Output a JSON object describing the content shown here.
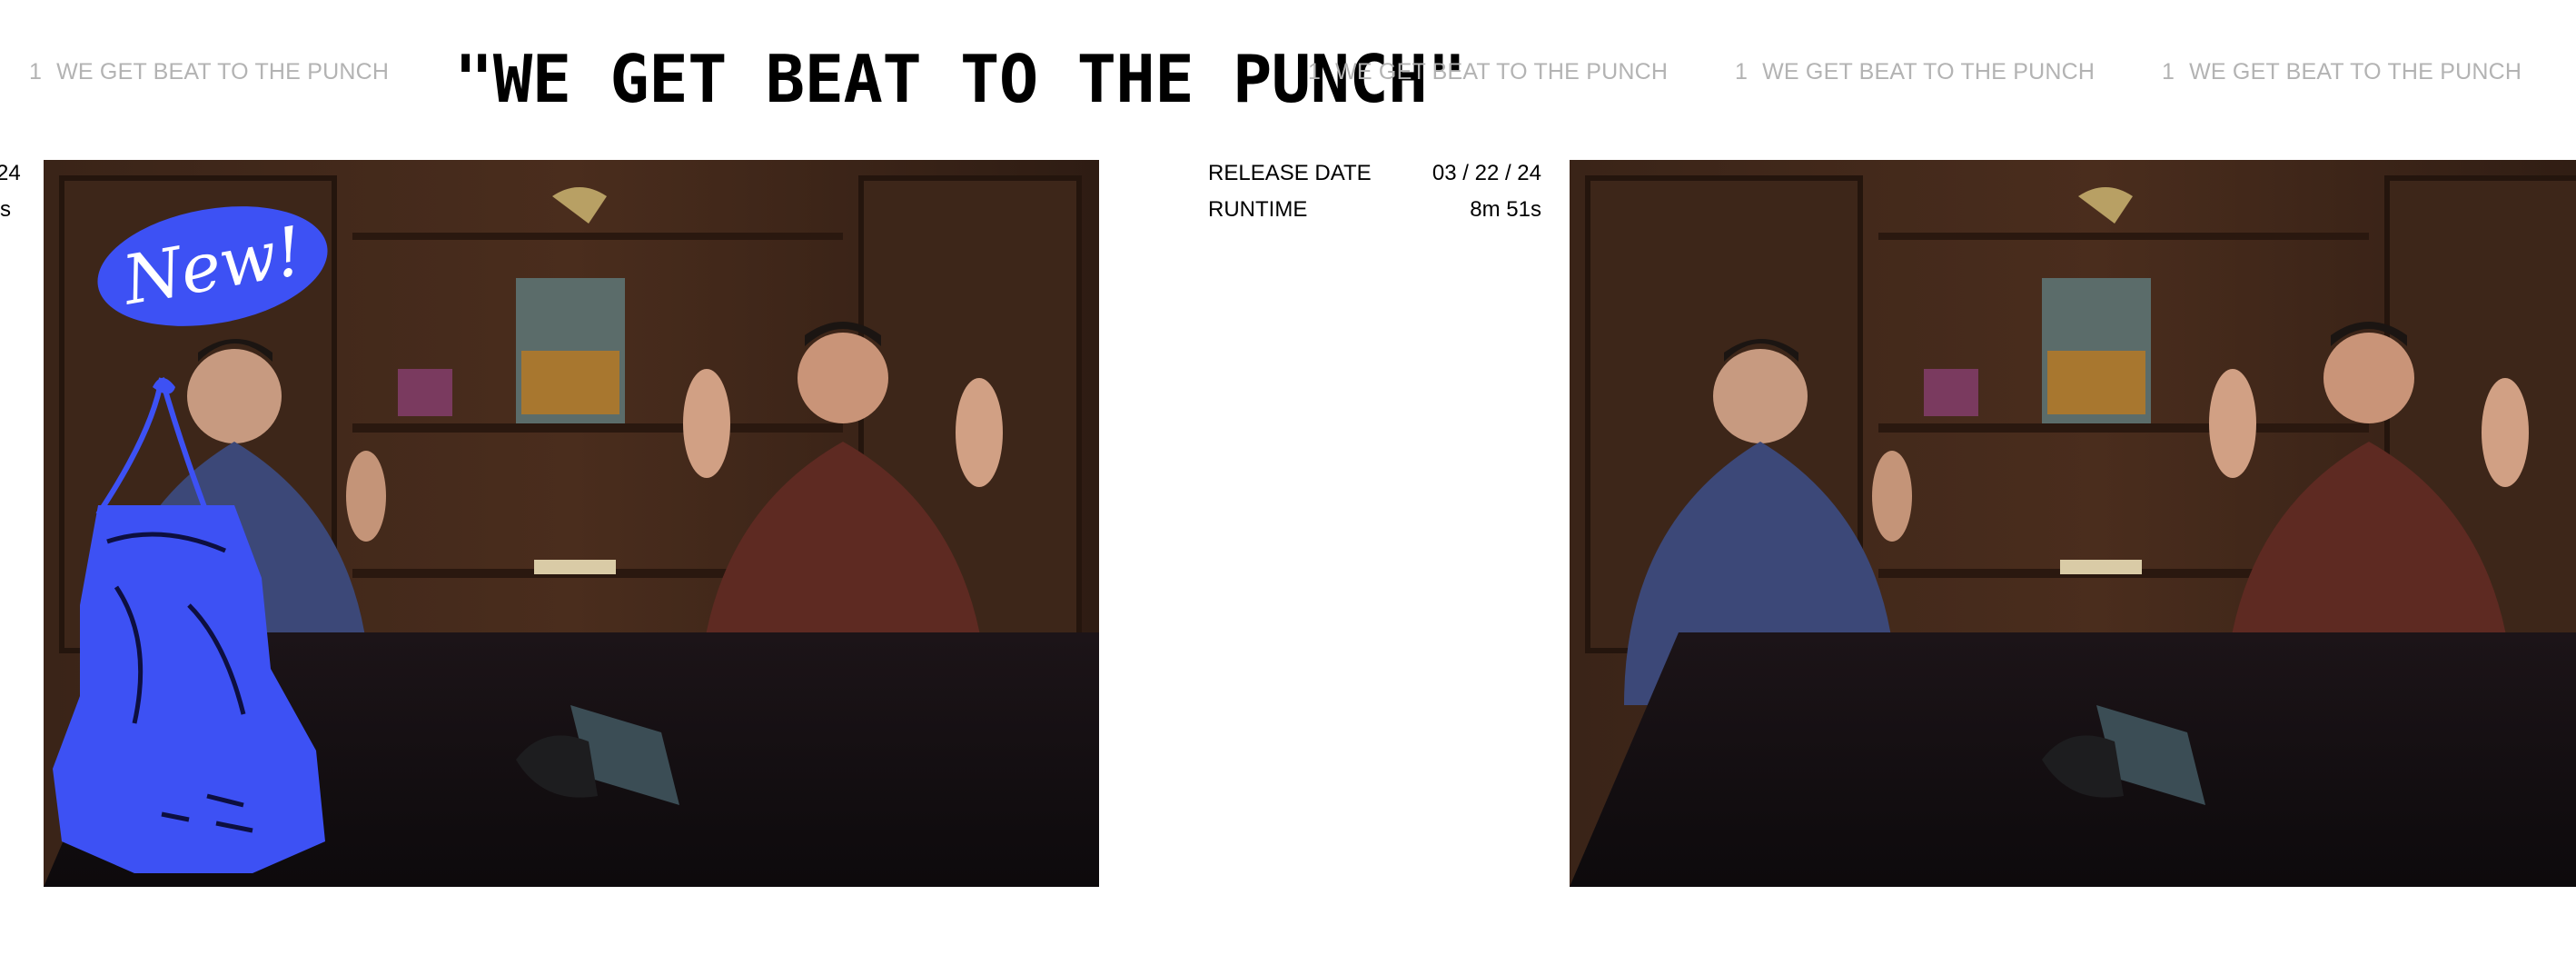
{
  "marquee": {
    "number": "1",
    "text": "WE GET BEAT TO THE PUNCH"
  },
  "headline": "\"WE GET BEAT TO THE PUNCH\"",
  "meta": {
    "release_label": "RELEASE DATE",
    "release_value": "03 / 22 / 24",
    "runtime_label": "RUNTIME",
    "runtime_value": "8m 51s",
    "clipped_release_value": "24",
    "clipped_runtime_value": "s"
  },
  "badge": {
    "text": "New!"
  },
  "colors": {
    "accent": "#3d51f4",
    "marquee_text": "#b3b3b3",
    "headline": "#000000"
  },
  "icons": {
    "boxing_glove": "boxing-glove-icon"
  }
}
